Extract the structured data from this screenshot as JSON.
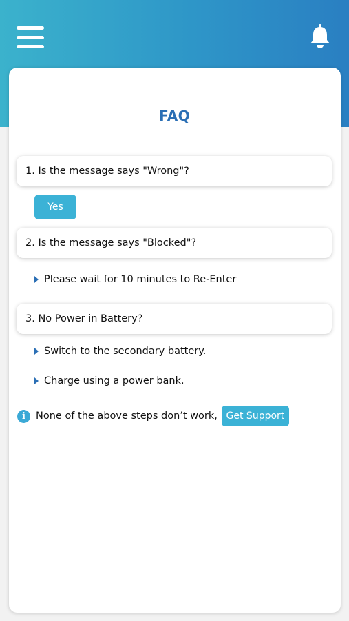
{
  "header": {
    "menu_icon": "hamburger-menu-icon",
    "bell_icon": "bell-icon"
  },
  "page": {
    "title": "FAQ"
  },
  "faq": [
    {
      "question": "1. Is the message says \"Wrong\"?",
      "action_label": "Yes"
    },
    {
      "question": "2. Is the message says \"Blocked\"?",
      "answers": [
        "Please wait for 10 minutes to Re-Enter"
      ]
    },
    {
      "question": "3. No Power in Battery?",
      "answers": [
        "Switch to the secondary battery.",
        "Charge using a power bank."
      ]
    }
  ],
  "support": {
    "info_icon": "info-icon",
    "text": "None of the above steps don’t work,",
    "button_label": "Get Support"
  },
  "colors": {
    "header_gradient_start": "#3bb2cc",
    "header_gradient_end": "#2a7fc2",
    "title": "#2b6fb5",
    "button": "#3bb2d6"
  }
}
